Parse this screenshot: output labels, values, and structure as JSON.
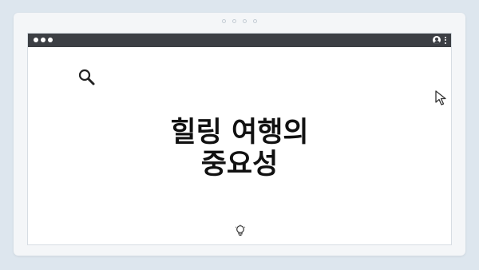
{
  "article": {
    "title_line1": "힐링 여행의",
    "title_line2": "중요성"
  },
  "icons": {
    "search": "search-icon",
    "cursor": "mouse-pointer-icon",
    "bulb": "lightbulb-icon",
    "profile": "profile-icon",
    "menu": "kebab-menu-icon"
  },
  "colors": {
    "background": "#dde6ee",
    "titlebar": "#3c3f44",
    "content_bg": "#ffffff",
    "text": "#111111"
  }
}
